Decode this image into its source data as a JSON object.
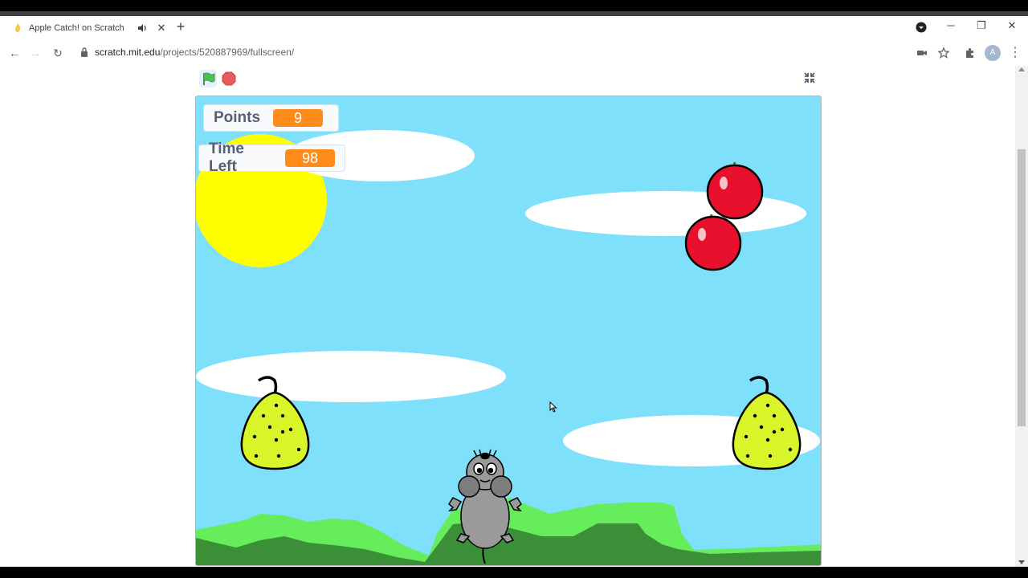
{
  "browser": {
    "tab": {
      "title": "Apple Catch! on Scratch",
      "close": "✕"
    },
    "new_tab": "+",
    "window_buttons": {
      "minimize": "─",
      "restore": "❐",
      "close": "✕"
    },
    "nav": {
      "back": "←",
      "forward": "→",
      "reload": "↻"
    },
    "address": {
      "host": "scratch.mit.edu",
      "path": "/projects/520887969/fullscreen/"
    },
    "profile_initial": "A",
    "menu": "⋮"
  },
  "stage": {
    "monitors": [
      {
        "label": "Points",
        "value": "9"
      },
      {
        "label": "Time Left",
        "value": "98"
      }
    ]
  },
  "colors": {
    "sky": "#7ee0fb",
    "sun": "#ffff00",
    "apple": "#e8102c",
    "pear": "#d8f52a",
    "grass_light": "#66ed5c",
    "grass_dark": "#3a8f37",
    "monitor_value": "#ff8c1a"
  }
}
